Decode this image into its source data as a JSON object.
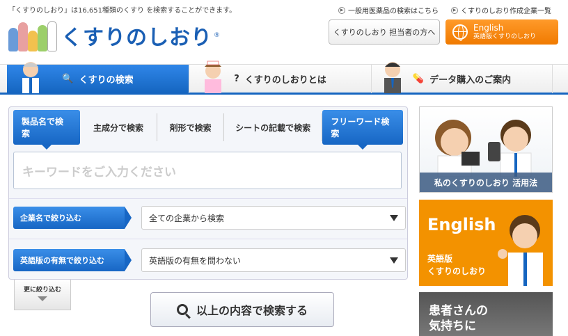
{
  "header": {
    "tagline": "「くすりのしおり」は16,651種類のくすり を検索することができます。",
    "logo_text": "くすりのしおり",
    "logo_reg": "®",
    "links": [
      {
        "label": "一般用医薬品の検索はこちら"
      },
      {
        "label": "くすりのしおり作成企業一覧"
      }
    ],
    "staff_button": "くすりのしおり 担当者の方へ",
    "english_button": {
      "main": "English",
      "sub": "英語版くすりのしおり"
    }
  },
  "nav": {
    "tabs": [
      {
        "label": "くすりの検索",
        "icon": "search-icon"
      },
      {
        "label": "くすりのしおりとは",
        "icon": "question-icon"
      },
      {
        "label": "データ購入のご案内",
        "icon": "pill-icon"
      }
    ]
  },
  "search": {
    "tabs": [
      "製品名で検索",
      "主成分で検索",
      "剤形で検索",
      "シートの記載で検索",
      "フリーワード検索"
    ],
    "keyword_placeholder": "キーワードをご入力ください",
    "filters": [
      {
        "label": "企業名で絞り込む",
        "value": "全ての企業から検索"
      },
      {
        "label": "英語版の有無で絞り込む",
        "value": "英語版の有無を問わない"
      }
    ],
    "more_filter": "更に絞り込む",
    "submit": "以上の内容で検索する"
  },
  "banners": {
    "usage": "私のくすりのしおり 活用法",
    "english": {
      "title": "English",
      "line1": "英語版",
      "line2": "くすりのしおり"
    },
    "patient": {
      "line1": "患者さんの",
      "line2": "気持ちに"
    }
  },
  "colors": {
    "primary": "#1565c0",
    "accent": "#f39200"
  }
}
